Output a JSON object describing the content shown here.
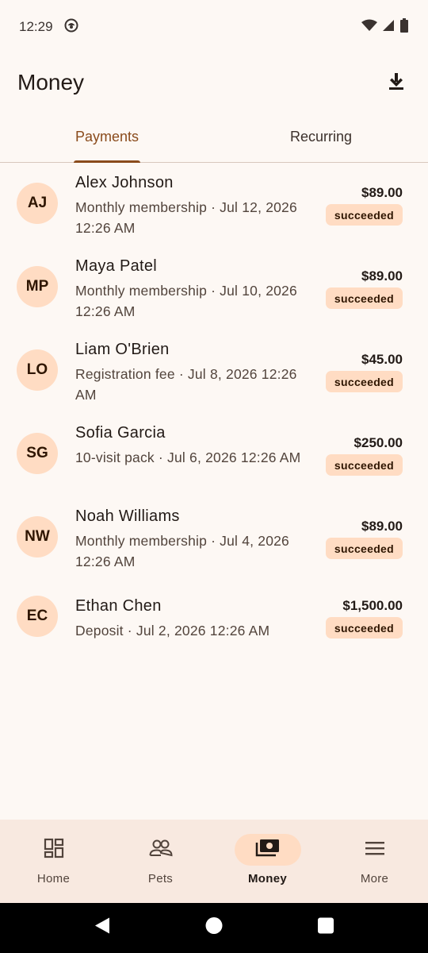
{
  "status_bar": {
    "time": "12:29"
  },
  "app_bar": {
    "title": "Money",
    "action_icon": "download-icon"
  },
  "tabs": [
    {
      "label": "Payments",
      "active": true
    },
    {
      "label": "Recurring",
      "active": false
    }
  ],
  "payments": [
    {
      "initials": "AJ",
      "name": "Alex Johnson",
      "description": "Monthly membership · Jul 12, 2026 12:26 AM",
      "amount": "$89.00",
      "status": "succeeded"
    },
    {
      "initials": "MP",
      "name": "Maya Patel",
      "description": "Monthly membership · Jul 10, 2026 12:26 AM",
      "amount": "$89.00",
      "status": "succeeded"
    },
    {
      "initials": "LO",
      "name": "Liam O'Brien",
      "description": "Registration fee · Jul 8, 2026 12:26 AM",
      "amount": "$45.00",
      "status": "succeeded"
    },
    {
      "initials": "SG",
      "name": "Sofia Garcia",
      "description": "10-visit pack · Jul 6, 2026 12:26 AM",
      "amount": "$250.00",
      "status": "succeeded"
    },
    {
      "initials": "NW",
      "name": "Noah Williams",
      "description": "Monthly membership · Jul 4, 2026 12:26 AM",
      "amount": "$89.00",
      "status": "succeeded"
    },
    {
      "initials": "EC",
      "name": "Ethan Chen",
      "description": "Deposit · Jul 2, 2026 12:26 AM",
      "amount": "$1,500.00",
      "status": "succeeded"
    }
  ],
  "bottom_nav": [
    {
      "label": "Home",
      "icon": "dashboard-icon",
      "active": false
    },
    {
      "label": "Pets",
      "icon": "group-icon",
      "active": false
    },
    {
      "label": "Money",
      "icon": "payments-icon",
      "active": true
    },
    {
      "label": "More",
      "icon": "menu-icon",
      "active": false
    }
  ],
  "colors": {
    "background": "#fdf8f4",
    "accent": "#8a4b1c",
    "badge_bg": "#ffdcc3",
    "nav_bg": "#f8e9e0"
  }
}
